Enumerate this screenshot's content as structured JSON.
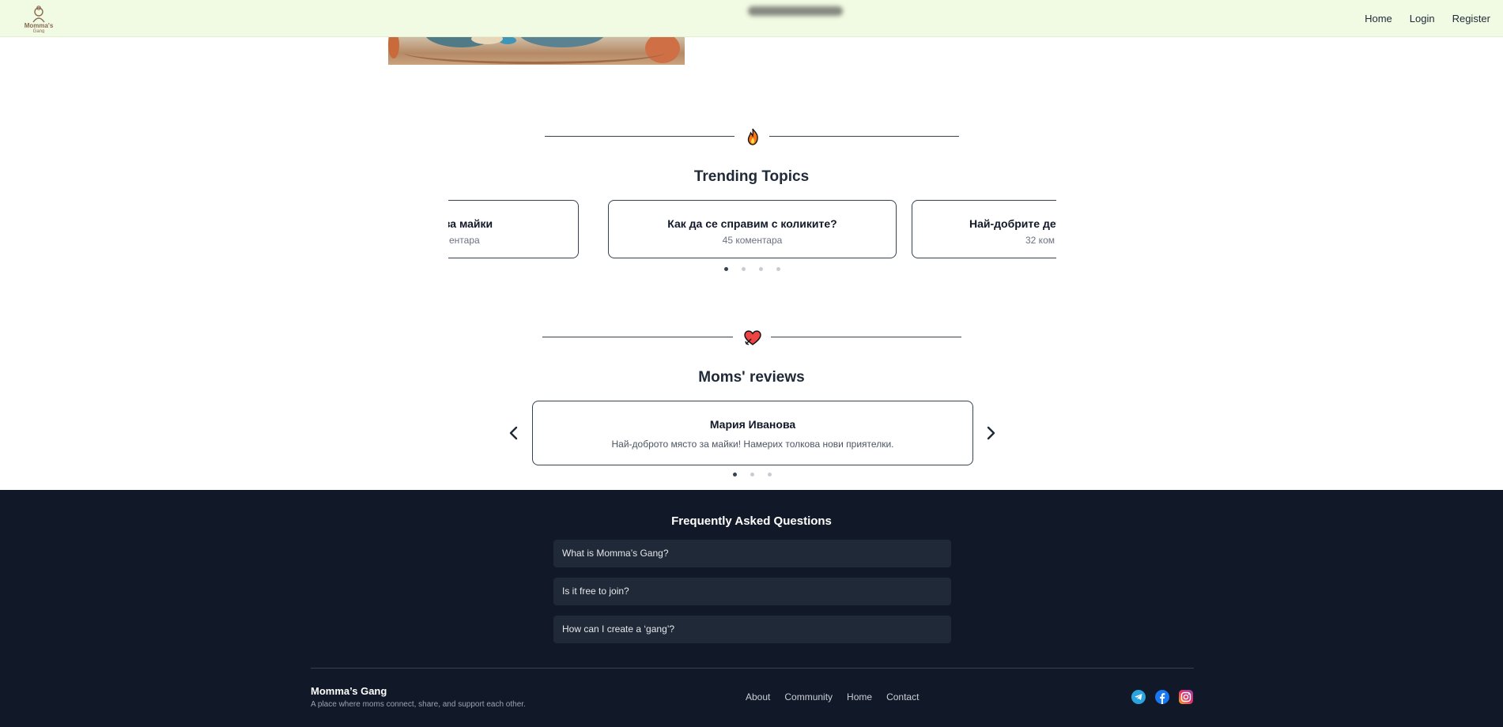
{
  "nav": {
    "logo_text": "Momma's Gang",
    "links": [
      "Home",
      "Login",
      "Register"
    ]
  },
  "trending": {
    "title": "Trending Topics",
    "icon": "fire-icon",
    "topics": [
      {
        "title": "ъщи за майки",
        "comments": "ентара"
      },
      {
        "title": "Как да се справим с коликите?",
        "comments": "45 коментара"
      },
      {
        "title": "Най-добрите дет",
        "comments": "32 ком"
      }
    ],
    "active_slide": 1,
    "slide_count": 4
  },
  "reviews": {
    "title": "Moms' reviews",
    "icon": "heart-icon",
    "items": [
      {
        "name": "Мария Иванова",
        "text": "Най-доброто място за майки! Намерих толкова нови приятелки."
      }
    ],
    "active_slide": 1,
    "slide_count": 3
  },
  "faq": {
    "title": "Frequently Asked Questions",
    "questions": [
      "What is Momma’s Gang?",
      "Is it free to join?",
      "How can I create a ‘gang’?"
    ]
  },
  "footer": {
    "brand": "Momma’s Gang",
    "tagline": "A place where moms connect, share, and support each other.",
    "links": [
      "About",
      "Community",
      "Home",
      "Contact"
    ],
    "socials": [
      "telegram-icon",
      "facebook-icon",
      "instagram-icon"
    ]
  },
  "colors": {
    "nav_bg": "#f1fae3",
    "footer_bg": "#111827",
    "faq_item_bg": "#1f2937",
    "card_border": "#374151"
  }
}
